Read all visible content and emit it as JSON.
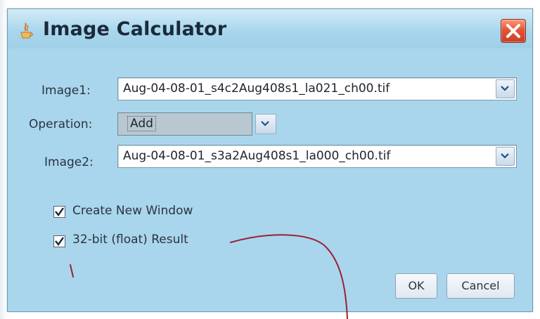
{
  "dialog": {
    "title": "Image Calculator",
    "icons": {
      "app": "java-cup-icon",
      "close": "close-icon",
      "dropdown": "chevron-down-icon",
      "check": "checkmark-icon"
    },
    "colors": {
      "background": "#a9d6ec",
      "close_button": "#e3553a",
      "annotation_ink": "#9b1f3a"
    }
  },
  "form": {
    "image1": {
      "label": "Image1:",
      "value": "Aug-04-08-01_s4c2Aug408s1_la021_ch00.tif"
    },
    "operation": {
      "label": "Operation:",
      "value": "Add"
    },
    "image2": {
      "label": "Image2:",
      "value": "Aug-04-08-01_s3a2Aug408s1_la000_ch00.tif"
    }
  },
  "options": {
    "create_new_window": {
      "label": "Create New Window",
      "checked": true
    },
    "float_result": {
      "label": "32-bit (float) Result",
      "checked": true
    }
  },
  "buttons": {
    "ok": "OK",
    "cancel": "Cancel"
  }
}
